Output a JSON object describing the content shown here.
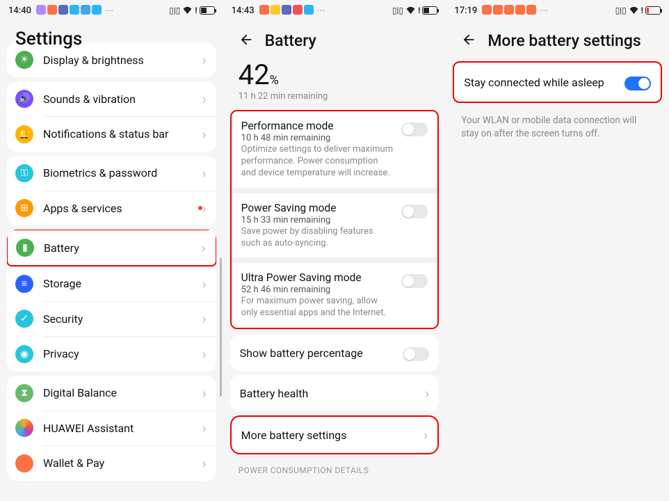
{
  "pane1": {
    "status": {
      "time": "14:40",
      "icons": [
        "#b388ff",
        "#ff7043",
        "#5c6bc0",
        "#29b6f6",
        "#42a5f5",
        "#29b6f6"
      ],
      "batt_pct": 45
    },
    "title": "Settings",
    "items": [
      {
        "label": "Display & brightness",
        "icon_bg": "#4caf50",
        "glyph": "☀",
        "name": "display-brightness"
      },
      {
        "label": "Sounds & vibration",
        "icon_bg": "#7c4dff",
        "glyph": "🔊",
        "name": "sounds-vibration"
      },
      {
        "label": "Notifications & status bar",
        "icon_bg": "#ffb300",
        "glyph": "🔔",
        "name": "notifications"
      },
      {
        "label": "Biometrics & password",
        "icon_bg": "#26c6da",
        "glyph": "⚿",
        "name": "biometrics"
      },
      {
        "label": "Apps & services",
        "icon_bg": "#ff9800",
        "glyph": "⊞",
        "name": "apps-services",
        "dot": true
      },
      {
        "label": "Battery",
        "icon_bg": "#4caf50",
        "glyph": "▮",
        "name": "battery",
        "highlight": true
      },
      {
        "label": "Storage",
        "icon_bg": "#2962ff",
        "glyph": "≡",
        "name": "storage"
      },
      {
        "label": "Security",
        "icon_bg": "#26c6da",
        "glyph": "✓",
        "name": "security"
      },
      {
        "label": "Privacy",
        "icon_bg": "#26c6da",
        "glyph": "◉",
        "name": "privacy"
      },
      {
        "label": "Digital Balance",
        "icon_bg": "#66bb6a",
        "glyph": "⧗",
        "name": "digital-balance"
      },
      {
        "label": "HUAWEI Assistant",
        "icon_bg": "grad",
        "glyph": "",
        "name": "huawei-assistant"
      },
      {
        "label": "Wallet & Pay",
        "icon_bg": "#ff7043",
        "glyph": "",
        "name": "wallet-pay"
      }
    ]
  },
  "pane2": {
    "status": {
      "time": "14:43",
      "icons": [
        "#ff7043",
        "#ffca28",
        "#5c6bc0",
        "#ef5350",
        "#29b6f6"
      ],
      "batt_pct": 42
    },
    "title": "Battery",
    "percent": "42",
    "percent_unit": "%",
    "remaining": "11 h 22 min remaining",
    "modes": [
      {
        "title": "Performance mode",
        "remain": "10 h 48 min remaining",
        "desc": "Optimize settings to deliver maximum performance. Power consumption and device temperature will increase.",
        "name": "performance-mode"
      },
      {
        "title": "Power Saving mode",
        "remain": "15 h 33 min remaining",
        "desc": "Save power by disabling features such as auto-syncing.",
        "name": "power-saving-mode"
      },
      {
        "title": "Ultra Power Saving mode",
        "remain": "52 h 46 min remaining",
        "desc": "For maximum power saving, allow only essential apps and the Internet.",
        "name": "ultra-power-saving-mode"
      }
    ],
    "show_pct_label": "Show battery percentage",
    "health_label": "Battery health",
    "more_label": "More battery settings",
    "section": "POWER CONSUMPTION DETAILS"
  },
  "pane3": {
    "status": {
      "time": "17:19",
      "icons": [
        "#ff7043",
        "#ff7043",
        "#ff7043",
        "#ff7043",
        "#ff7043"
      ],
      "batt_pct": 18,
      "batt_low": true
    },
    "title": "More battery settings",
    "stay_label": "Stay connected while asleep",
    "stay_on": true,
    "note": "Your WLAN or mobile data connection will stay on after the screen turns off."
  }
}
